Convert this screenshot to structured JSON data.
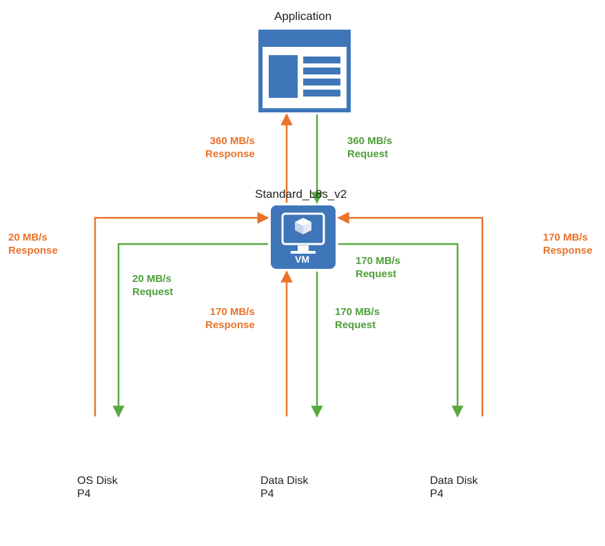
{
  "nodes": {
    "application": {
      "label": "Application"
    },
    "vm": {
      "label": "Standard_L8s_v2",
      "caption": "VM"
    },
    "os_disk": {
      "line1": "OS Disk",
      "line2": "P4"
    },
    "data_disk_1": {
      "line1": "Data Disk",
      "line2": "P4"
    },
    "data_disk_2": {
      "line1": "Data Disk",
      "line2": "P4"
    }
  },
  "flows": {
    "app_response": {
      "line1": "360 MB/s",
      "line2": "Response"
    },
    "app_request": {
      "line1": "360 MB/s",
      "line2": "Request"
    },
    "os_response": {
      "line1": "20 MB/s",
      "line2": "Response"
    },
    "os_request": {
      "line1": "20 MB/s",
      "line2": "Request"
    },
    "dd1_response": {
      "line1": "170 MB/s",
      "line2": "Response"
    },
    "dd1_request": {
      "line1": "170 MB/s",
      "line2": "Request"
    },
    "dd2_response": {
      "line1": "170 MB/s",
      "line2": "Response"
    },
    "dd2_request": {
      "line1": "170 MB/s",
      "line2": "Request"
    }
  },
  "colors": {
    "blue": "#3e76b9",
    "blue_dark": "#35659e",
    "orange": "#e8732a",
    "green": "#58a942"
  }
}
